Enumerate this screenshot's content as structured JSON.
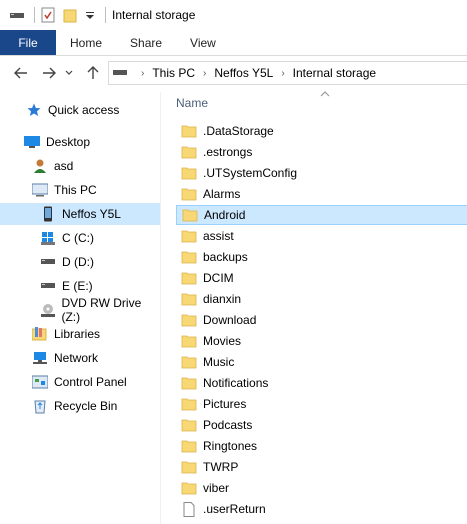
{
  "window": {
    "title": "Internal storage"
  },
  "ribbon": {
    "tabs": [
      {
        "label": "File",
        "active": true
      },
      {
        "label": "Home"
      },
      {
        "label": "Share"
      },
      {
        "label": "View"
      }
    ]
  },
  "address": {
    "segments": [
      "This PC",
      "Neffos Y5L",
      "Internal storage"
    ]
  },
  "nav": {
    "items": [
      {
        "label": "Quick access",
        "icon": "star-icon"
      },
      {
        "label": "Desktop",
        "icon": "desktop-icon"
      },
      {
        "label": "asd",
        "icon": "user-folder-icon"
      },
      {
        "label": "This PC",
        "icon": "computer-icon"
      },
      {
        "label": "Neffos Y5L",
        "icon": "phone-icon",
        "selected": true
      },
      {
        "label": "C (C:)",
        "icon": "windows-drive-icon"
      },
      {
        "label": "D (D:)",
        "icon": "drive-icon"
      },
      {
        "label": "E (E:)",
        "icon": "drive-icon"
      },
      {
        "label": "DVD RW Drive (Z:)",
        "icon": "dvd-drive-icon"
      },
      {
        "label": "Libraries",
        "icon": "libraries-icon"
      },
      {
        "label": "Network",
        "icon": "network-icon"
      },
      {
        "label": "Control Panel",
        "icon": "control-panel-icon"
      },
      {
        "label": "Recycle Bin",
        "icon": "recycle-bin-icon"
      }
    ]
  },
  "content": {
    "column_header": "Name",
    "files": [
      {
        "name": ".DataStorage",
        "type": "folder"
      },
      {
        "name": ".estrongs",
        "type": "folder"
      },
      {
        "name": ".UTSystemConfig",
        "type": "folder"
      },
      {
        "name": "Alarms",
        "type": "folder"
      },
      {
        "name": "Android",
        "type": "folder",
        "selected": true
      },
      {
        "name": "assist",
        "type": "folder"
      },
      {
        "name": "backups",
        "type": "folder"
      },
      {
        "name": "DCIM",
        "type": "folder"
      },
      {
        "name": "dianxin",
        "type": "folder"
      },
      {
        "name": "Download",
        "type": "folder"
      },
      {
        "name": "Movies",
        "type": "folder"
      },
      {
        "name": "Music",
        "type": "folder"
      },
      {
        "name": "Notifications",
        "type": "folder"
      },
      {
        "name": "Pictures",
        "type": "folder"
      },
      {
        "name": "Podcasts",
        "type": "folder"
      },
      {
        "name": "Ringtones",
        "type": "folder"
      },
      {
        "name": "TWRP",
        "type": "folder"
      },
      {
        "name": "viber",
        "type": "folder"
      },
      {
        "name": ".userReturn",
        "type": "file"
      }
    ]
  },
  "colors": {
    "file_tab": "#19478a",
    "selection": "#cce8ff",
    "folder": "#f8d775"
  }
}
